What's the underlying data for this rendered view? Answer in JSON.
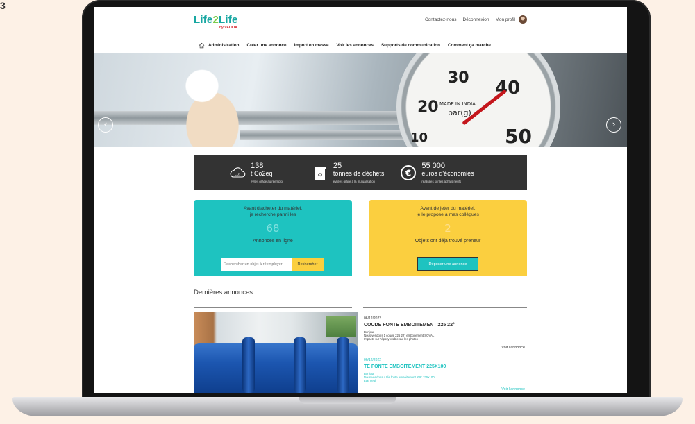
{
  "corner_mark": "3",
  "colors": {
    "teal": "#1ec3c0",
    "yellow": "#fbcf3f",
    "dark": "#333333",
    "logo_green": "#7ccc4b",
    "veolia_red": "#d6232a"
  },
  "header": {
    "logo_part1": "Life",
    "logo_part2": "2",
    "logo_part3": "Life",
    "logo_sub": "by VEOLIA",
    "links": [
      "Contactez-nous",
      "Déconnexion",
      "Mon profil"
    ]
  },
  "nav": {
    "home_icon": "home-icon",
    "items": [
      "Administration",
      "Créer une annonce",
      "Import en masse",
      "Voir les annonces",
      "Supports de communication",
      "Comment ça marche"
    ]
  },
  "hero": {
    "gauge_numbers": [
      "30",
      "40",
      "20",
      "10",
      "50"
    ],
    "gauge_text": "MADE IN INDIA",
    "gauge_unit": "bar(g)",
    "prev_icon": "chevron-left-icon",
    "next_icon": "chevron-right-icon",
    "prev_glyph": "‹",
    "next_glyph": "›"
  },
  "stats": [
    {
      "icon": "co2-cloud-icon",
      "icon_text": "CO₂",
      "number": "138",
      "label": "t Co2eq",
      "sub": "évités grâce au réemploi"
    },
    {
      "icon": "recycle-bin-icon",
      "icon_text": "♻",
      "number": "25",
      "label": "tonnes de déchets",
      "sub": "évitées grâce à la mutualisation"
    },
    {
      "icon": "euro-icon",
      "icon_text": "€",
      "number": "55 000",
      "label": "euros d'économies",
      "sub": "réalisées sur les achats neufs"
    }
  ],
  "buy_card": {
    "intro_line1": "Avant d'acheter du matériel,",
    "intro_line2": "je recherche parmi les",
    "count": "68",
    "label": "Annonces en ligne",
    "search_placeholder": "Rechercher un objet à réemployer",
    "search_button": "Rechercher"
  },
  "give_card": {
    "intro_line1": "Avant de jeter du matériel,",
    "intro_line2": "je le propose à mes collègues",
    "count": "2",
    "label": "Objets ont déjà trouvé preneur",
    "deposit_button": "Déposer une annonce"
  },
  "latest": {
    "title": "Dernières annonces",
    "listings": [
      {
        "date": "06/12/2022",
        "title": "COUDE FONTE EMBOITEMENT 225 22°",
        "desc_line1": "Bonjour",
        "desc_line2": "Nous vendons 1 coude 225 22° emboitement SOVAL",
        "desc_line3": "Impacts sur l'époxy visible sur les photos",
        "link": "Voir l'annonce"
      },
      {
        "date": "06/12/2022",
        "title": "TE FONTE EMBOITEMENT 225X100",
        "desc_line1": "Bonjour",
        "desc_line2": "Nous vendons 4 tés fonte emboitement AVK 225x100",
        "desc_line3": "Etat neuf",
        "link": "Voir l'annonce"
      }
    ]
  }
}
